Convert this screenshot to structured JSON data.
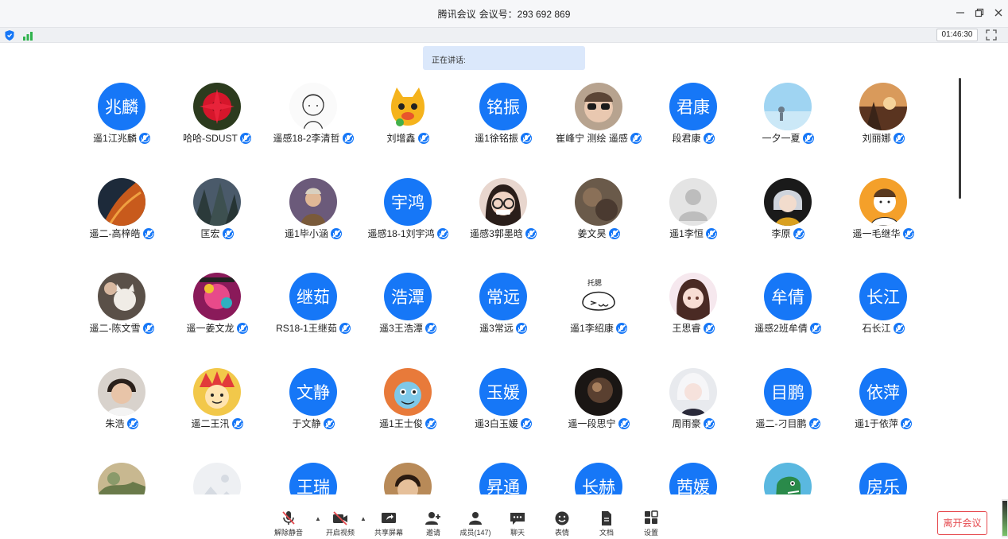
{
  "window": {
    "app_name": "腾讯会议",
    "meeting_id_label": "会议号：293 692 869"
  },
  "status": {
    "timer": "01:46:30"
  },
  "speaking": {
    "label": "正在讲话:"
  },
  "colors": {
    "accent": "#1677f7",
    "leave": "#e5484d",
    "speaking_bg": "#dbe8fb"
  },
  "participants": [
    {
      "name": "遥1江兆麟",
      "avatar_text": "兆麟"
    },
    {
      "name": "哈哈-SDUST",
      "avatar_icon": "red-flower-photo"
    },
    {
      "name": "遥感18-2李清哲",
      "avatar_icon": "line-drawing-boy"
    },
    {
      "name": "刘增鑫",
      "avatar_icon": "cartoon-cat"
    },
    {
      "name": "遥1徐铭振",
      "avatar_text": "铭振"
    },
    {
      "name": "崔峰宁 测绘 遥感",
      "avatar_icon": "sunglasses-photo"
    },
    {
      "name": "段君康",
      "avatar_text": "君康"
    },
    {
      "name": "一夕一夏",
      "avatar_icon": "sky-photo"
    },
    {
      "name": "刘丽娜",
      "avatar_icon": "sunset-photo"
    },
    {
      "name": "遥二-高梓皓",
      "avatar_icon": "dark-orange-photo"
    },
    {
      "name": "匡宏",
      "avatar_icon": "forest-photo"
    },
    {
      "name": "遥1毕小涵",
      "avatar_icon": "painting-photo"
    },
    {
      "name": "遥感18-1刘宇鸿",
      "avatar_text": "宇鸿"
    },
    {
      "name": "遥感3郭墨晗",
      "avatar_icon": "glasses-girl-photo"
    },
    {
      "name": "姜文昊",
      "avatar_icon": "blurry-photo"
    },
    {
      "name": "遥1李恒",
      "avatar_icon": "default-person"
    },
    {
      "name": "李原",
      "avatar_icon": "anime-character"
    },
    {
      "name": "遥一毛继华",
      "avatar_icon": "cartoon-guy"
    },
    {
      "name": "遥二-陈文雪",
      "avatar_icon": "cat-photo"
    },
    {
      "name": "遥一姜文龙",
      "avatar_icon": "album-cover"
    },
    {
      "name": "RS18-1王继茹",
      "avatar_text": "继茹"
    },
    {
      "name": "遥3王浩潭",
      "avatar_text": "浩潭"
    },
    {
      "name": "遥3常远",
      "avatar_text": "常远"
    },
    {
      "name": "遥1李绍康",
      "avatar_icon": "doodle-face"
    },
    {
      "name": "王思睿",
      "avatar_icon": "anime-girl"
    },
    {
      "name": "遥感2班牟倩",
      "avatar_text": "牟倩"
    },
    {
      "name": "石长江",
      "avatar_text": "长江"
    },
    {
      "name": "朱浩",
      "avatar_icon": "portrait-photo"
    },
    {
      "name": "遥二王汛",
      "avatar_icon": "cartoon-character"
    },
    {
      "name": "于文静",
      "avatar_text": "文静"
    },
    {
      "name": "遥1王士俊",
      "avatar_icon": "pokemon-squirtle"
    },
    {
      "name": "遥3白玉媛",
      "avatar_text": "玉媛"
    },
    {
      "name": "遥一段思宁",
      "avatar_icon": "dark-planet"
    },
    {
      "name": "周雨豪",
      "avatar_icon": "anime-white-hair"
    },
    {
      "name": "遥二-刁目鹏",
      "avatar_text": "目鹏"
    },
    {
      "name": "遥1于依萍",
      "avatar_text": "依萍"
    },
    {
      "name": "",
      "avatar_icon": "nature-photo"
    },
    {
      "name": "",
      "avatar_icon": "image-placeholder"
    },
    {
      "name": "",
      "avatar_text": "王瑞"
    },
    {
      "name": "",
      "avatar_icon": "man-photo"
    },
    {
      "name": "",
      "avatar_text": "昇通"
    },
    {
      "name": "",
      "avatar_text": "长赫"
    },
    {
      "name": "",
      "avatar_text": "茜媛"
    },
    {
      "name": "",
      "avatar_icon": "green-dinosaur"
    },
    {
      "name": "",
      "avatar_text": "房乐"
    }
  ],
  "toolbar": {
    "unmute": "解除静音",
    "start_video": "开启视频",
    "share_screen": "共享屏幕",
    "invite": "邀请",
    "members": "成员(147)",
    "chat": "聊天",
    "reactions": "表情",
    "docs": "文档",
    "settings": "设置",
    "leave": "离开会议"
  }
}
